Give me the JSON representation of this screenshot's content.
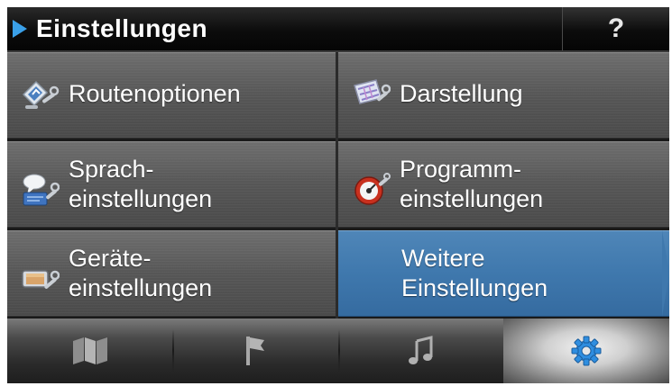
{
  "header": {
    "title": "Einstellungen",
    "help_label": "?"
  },
  "menu": {
    "items": [
      {
        "label": "Routenoptionen",
        "icon": "route-options-icon"
      },
      {
        "label": "Darstellung",
        "icon": "display-icon"
      },
      {
        "line1": "Sprach-",
        "line2": "einstellungen",
        "icon": "language-settings-icon"
      },
      {
        "line1": "Programm-",
        "line2": "einstellungen",
        "icon": "program-settings-icon"
      },
      {
        "line1": "Geräte-",
        "line2": "einstellungen",
        "icon": "device-settings-icon"
      },
      {
        "line1": "Weitere",
        "line2": "Einstellungen",
        "active": true
      }
    ]
  },
  "navbar": {
    "items": [
      {
        "icon": "map-icon"
      },
      {
        "icon": "flag-icon"
      },
      {
        "icon": "music-note-icon"
      },
      {
        "icon": "gear-icon",
        "active": true
      }
    ]
  },
  "colors": {
    "accent": "#3f78ad",
    "arrow": "#3aa0e8",
    "gear": "#2f8ee0"
  }
}
